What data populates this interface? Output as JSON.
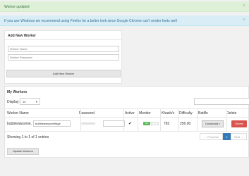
{
  "alerts": {
    "success": "Worker updated",
    "info": "If you use Windows we recommend using Firefox for a better look since Google Chrome can't render fonts well",
    "close": "×"
  },
  "add_worker": {
    "title": "Add New Worker",
    "name_placeholder": "Worker Name",
    "password_placeholder": "Worker Password",
    "button": "Add New Worker"
  },
  "workers": {
    "title": "My Workers",
    "display_label": "Display:",
    "display_value": "10",
    "columns": [
      "Worker Name",
      "Password",
      "Active",
      "Monitor",
      "Khash/s",
      "Difficulty",
      "Batfile",
      "Delete"
    ],
    "rows": [
      {
        "name_prefix": "bubbleawsome.",
        "name_value": "bubbleawsome9age",
        "active": "✔",
        "monitor": "ON",
        "khash": "782",
        "difficulty": "256.00",
        "batfile": "Download",
        "delete": "Delete"
      }
    ],
    "info": "Showing 1 to 1 of 1 entries",
    "pagination": {
      "previous": "← Previous",
      "current": "1",
      "next": "Next →"
    },
    "update_button": "Update Workers"
  },
  "colors": {
    "success_bg": "#dff0d8",
    "info_bg": "#d9edf7",
    "delete": "#d9534f",
    "monitor_on": "#5cb85c",
    "page_active": "#337ab7"
  }
}
